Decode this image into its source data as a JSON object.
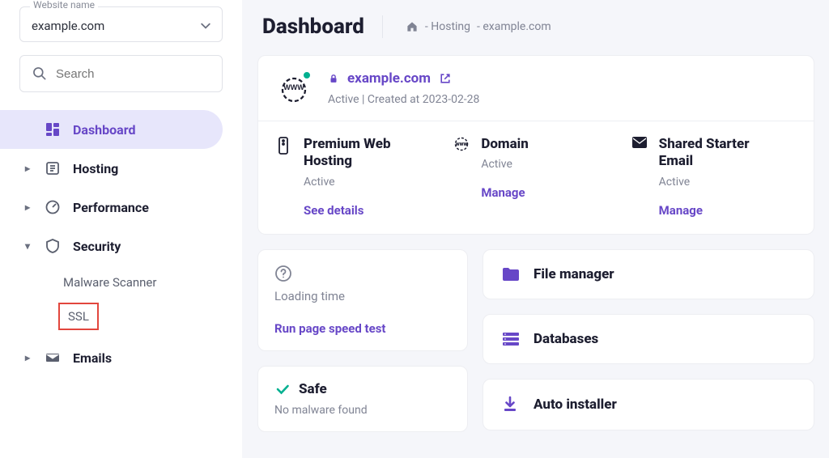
{
  "websiteLabel": "Website name",
  "websiteValue": "example.com",
  "searchPlaceholder": "Search",
  "nav": {
    "dashboard": "Dashboard",
    "hosting": "Hosting",
    "performance": "Performance",
    "security": "Security",
    "securityChildren": {
      "malware": "Malware Scanner",
      "ssl": "SSL"
    },
    "emails": "Emails"
  },
  "pageTitle": "Dashboard",
  "breadcrumb": {
    "seg1": "- Hosting",
    "seg2": "- example.com"
  },
  "site": {
    "domain": "example.com",
    "status": "Active | Created at 2023-02-28"
  },
  "tiles": {
    "a": {
      "title1": "Premium Web",
      "title2": "Hosting",
      "status": "Active",
      "action": "See details"
    },
    "b": {
      "title": "Domain",
      "status": "Active",
      "action": "Manage"
    },
    "c": {
      "title1": "Shared Starter",
      "title2": "Email",
      "status": "Active",
      "action": "Manage"
    }
  },
  "mini": {
    "loading": {
      "label": "Loading time",
      "action": "Run page speed test"
    },
    "safe": {
      "title": "Safe",
      "sub": "No malware found"
    }
  },
  "tools": {
    "filemanager": "File manager",
    "databases": "Databases",
    "autoinstaller": "Auto installer"
  }
}
